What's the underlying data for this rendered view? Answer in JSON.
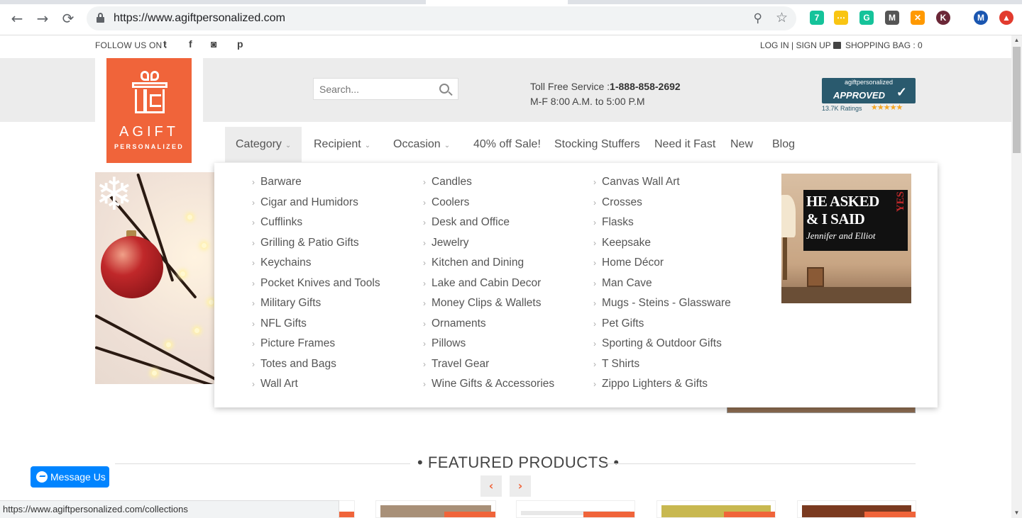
{
  "browser": {
    "url": "https://www.agiftpersonalized.com",
    "back_icon": "←",
    "forward_icon": "→",
    "reload_icon": "⟳",
    "zoom_icon": "⚲",
    "star_icon": "☆",
    "extensions": [
      {
        "name": "grammarly-ext",
        "color": "#15c39a",
        "label": "7"
      },
      {
        "name": "notes-ext",
        "color": "#f9c513",
        "label": "⋯"
      },
      {
        "name": "g-ext",
        "color": "#15c39a",
        "label": "G"
      },
      {
        "name": "m-ext",
        "color": "#555555",
        "label": "M"
      },
      {
        "name": "x-ext",
        "color": "#ff9900",
        "label": "✕"
      },
      {
        "name": "k-ext",
        "color": "#6b2737",
        "label": "K"
      },
      {
        "name": "profile-ext",
        "color": "#1a56b0",
        "label": "M"
      },
      {
        "name": "red-ext",
        "color": "#e23b2e",
        "label": "▲"
      }
    ]
  },
  "topbar": {
    "follow_label": "FOLLOW US ON :",
    "social": [
      "t",
      "f",
      "◙",
      "p"
    ],
    "account": "LOG IN | SIGN UP",
    "bag": "SHOPPING BAG : 0"
  },
  "logo": {
    "line1": "AGIFT",
    "line2": "PERSONALIZED"
  },
  "search": {
    "placeholder": "Search..."
  },
  "contact": {
    "label": "Toll Free Service :",
    "phone": "1-888-858-2692",
    "hours": "M-F 8:00 A.M. to 5:00 P.M"
  },
  "badge": {
    "site": "agiftpersonalized",
    "approved": "APPROVED",
    "ratings": "13.7K Ratings",
    "stars": "★★★★★"
  },
  "nav": {
    "items": [
      {
        "label": "Category",
        "chev": "⌄"
      },
      {
        "label": "Recipient",
        "chev": "⌄"
      },
      {
        "label": "Occasion",
        "chev": "⌄"
      },
      {
        "label": "40% off Sale!"
      },
      {
        "label": "Stocking Stuffers"
      },
      {
        "label": "Need it Fast"
      },
      {
        "label": "New"
      },
      {
        "label": "Blog"
      }
    ]
  },
  "dropdown": {
    "arrow": "›",
    "columns": [
      [
        "Barware",
        "Cigar and Humidors",
        "Cufflinks",
        "Grilling & Patio Gifts",
        "Keychains",
        "Pocket Knives and Tools",
        "Military Gifts",
        "NFL Gifts",
        "Picture Frames",
        "Totes and Bags",
        "Wall Art"
      ],
      [
        "Candles",
        "Coolers",
        "Desk and Office",
        "Jewelry",
        "Kitchen and Dining",
        "Lake and Cabin Decor",
        "Money Clips & Wallets",
        "Ornaments",
        "Pillows",
        "Travel Gear",
        "Wine Gifts & Accessories"
      ],
      [
        "Canvas Wall Art",
        "Crosses",
        "Flasks",
        "Keepsake",
        "Home Décor",
        "Man Cave",
        "Mugs - Steins - Glassware",
        "Pet Gifts",
        "Sporting & Outdoor Gifts",
        "T Shirts",
        "Zippo Lighters & Gifts"
      ]
    ],
    "promo": {
      "line1": "HE ASKED",
      "line2": "& I SAID",
      "yes": "YES",
      "names": "Jennifer and Elliot"
    }
  },
  "featured": {
    "title": "• FEATURED PRODUCTS •",
    "prev": "‹",
    "next": "›"
  },
  "messenger": {
    "label": "Message Us"
  },
  "status": {
    "url": "https://www.agiftpersonalized.com/collections"
  },
  "scrollbar": {
    "up": "▲",
    "down": "▼"
  }
}
